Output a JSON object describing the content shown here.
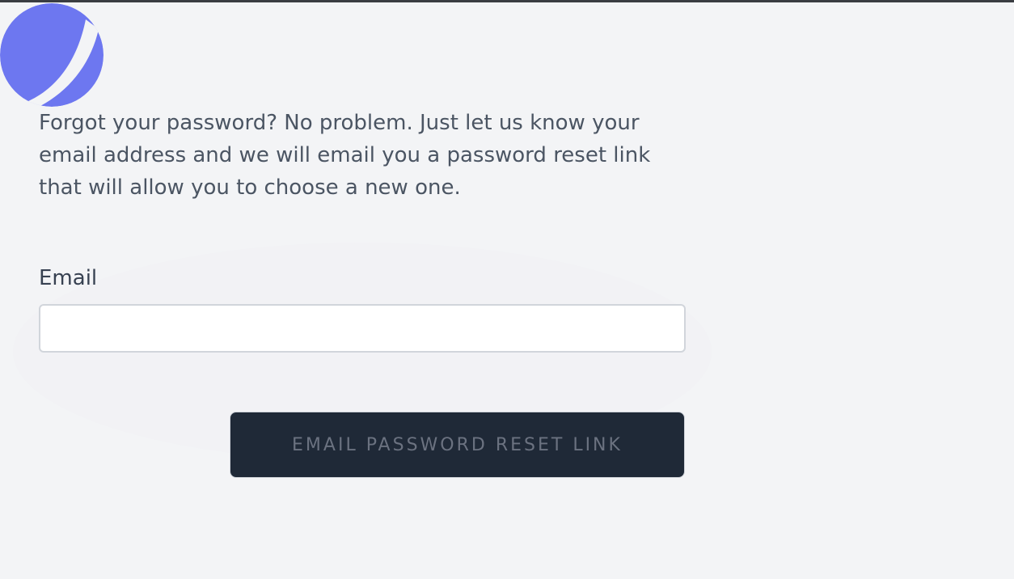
{
  "description": "Forgot your password? No problem. Just let us know your email address and we will email you a password reset link that will allow you to choose a new one.",
  "form": {
    "email_label": "Email",
    "email_value": "",
    "email_placeholder": "",
    "submit_label": "EMAIL PASSWORD RESET LINK"
  },
  "logo": {
    "icon": "logo-icon",
    "color": "#6d77f0"
  },
  "colors": {
    "background": "#f3f4f6",
    "button_bg": "#1f2937",
    "button_text": "#6b7280",
    "text": "#4b5563",
    "input_border": "#d1d5db"
  }
}
